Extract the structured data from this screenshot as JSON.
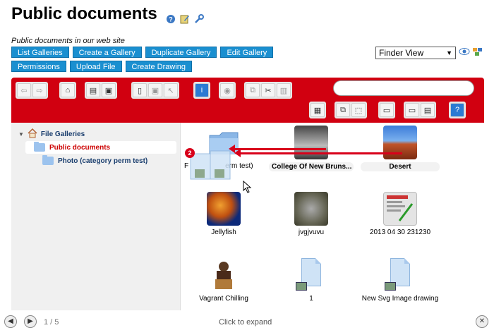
{
  "page": {
    "title": "Public documents",
    "description": "Public documents in our web site"
  },
  "title_icons": [
    "help-icon",
    "edit-icon",
    "wrench-icon"
  ],
  "actions": {
    "row1": [
      "List Galleries",
      "Create a Gallery",
      "Duplicate Gallery",
      "Edit Gallery"
    ],
    "row2": [
      "Permissions",
      "Upload File",
      "Create Drawing"
    ]
  },
  "view_select": {
    "value": "Finder View"
  },
  "toolbar": {
    "search_placeholder": ""
  },
  "tree": {
    "root": "File Galleries",
    "current": "Public documents",
    "child": "Photo (category perm test)"
  },
  "files": [
    {
      "label": "Photo (category perm test)",
      "partial": "F",
      "suffix": "erm test)",
      "kind": "folder"
    },
    {
      "label": "College Of New Bruns...",
      "kind": "image-bw"
    },
    {
      "label": "Desert",
      "kind": "image-desert"
    },
    {
      "label": "Jellyfish",
      "kind": "image-jelly"
    },
    {
      "label": "jvgjvuvu",
      "kind": "image-koala"
    },
    {
      "label": "2013 04 30 231230",
      "kind": "image-screenshot"
    },
    {
      "label": "Vagrant Chilling",
      "kind": "image-vagrant"
    },
    {
      "label": "1",
      "kind": "document"
    },
    {
      "label": "New Svg Image drawing",
      "kind": "document"
    }
  ],
  "drag": {
    "count": "2"
  },
  "footer": {
    "counter": "1 / 5",
    "expand": "Click to expand"
  },
  "colors": {
    "toolbar_red": "#d10010",
    "button_blue": "#1a8fd0",
    "tree_selected_red": "#cc0000"
  }
}
